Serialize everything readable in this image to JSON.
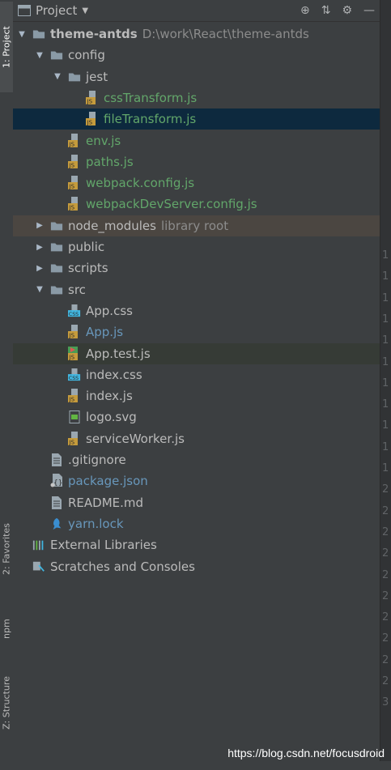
{
  "toolwindow_tabs": {
    "project": "1: Project",
    "favorites": "2: Favorites",
    "npm": "npm",
    "structure": "Z: Structure"
  },
  "header": {
    "title": "Project"
  },
  "tree": [
    {
      "name": "theme-antds",
      "hint": "D:\\work\\React\\theme-antds",
      "icon": "folder-icon",
      "kind": "root"
    },
    {
      "name": "config",
      "icon": "folder-icon",
      "kind": "folder"
    },
    {
      "name": "jest",
      "icon": "folder-icon",
      "kind": "folder"
    },
    {
      "name": "cssTransform.js",
      "icon": "js-file-icon",
      "kind": "green"
    },
    {
      "name": "fileTransform.js",
      "icon": "js-file-icon",
      "kind": "green"
    },
    {
      "name": "env.js",
      "icon": "js-file-icon",
      "kind": "green"
    },
    {
      "name": "paths.js",
      "icon": "js-file-icon",
      "kind": "green"
    },
    {
      "name": "webpack.config.js",
      "icon": "js-file-icon",
      "kind": "green"
    },
    {
      "name": "webpackDevServer.config.js",
      "icon": "js-file-icon",
      "kind": "green"
    },
    {
      "name": "node_modules",
      "hint": "library root",
      "icon": "folder-icon",
      "kind": "folder"
    },
    {
      "name": "public",
      "icon": "folder-icon",
      "kind": "folder"
    },
    {
      "name": "scripts",
      "icon": "folder-icon",
      "kind": "folder"
    },
    {
      "name": "src",
      "icon": "folder-icon",
      "kind": "folder"
    },
    {
      "name": "App.css",
      "icon": "css-file-icon",
      "kind": "white"
    },
    {
      "name": "App.js",
      "icon": "js-file-icon",
      "kind": "blue"
    },
    {
      "name": "App.test.js",
      "icon": "test-file-icon",
      "kind": "white"
    },
    {
      "name": "index.css",
      "icon": "css-file-icon",
      "kind": "white"
    },
    {
      "name": "index.js",
      "icon": "js-file-icon",
      "kind": "white"
    },
    {
      "name": "logo.svg",
      "icon": "svg-file-icon",
      "kind": "white"
    },
    {
      "name": "serviceWorker.js",
      "icon": "js-file-icon",
      "kind": "white"
    },
    {
      "name": ".gitignore",
      "icon": "text-file-icon",
      "kind": "white"
    },
    {
      "name": "package.json",
      "icon": "json-file-icon",
      "kind": "blue"
    },
    {
      "name": "README.md",
      "icon": "text-file-icon",
      "kind": "white"
    },
    {
      "name": "yarn.lock",
      "icon": "yarn-icon",
      "kind": "blue"
    },
    {
      "name": "External Libraries",
      "icon": "libraries-icon",
      "kind": "white"
    },
    {
      "name": "Scratches and Consoles",
      "icon": "scratches-icon",
      "kind": "white"
    }
  ],
  "gutter_numbers": [
    "1",
    "1",
    "1",
    "1",
    "1",
    "1",
    "1",
    "1",
    "1",
    "1",
    "1",
    "2",
    "2",
    "2",
    "2",
    "2",
    "2",
    "2",
    "2",
    "2",
    "2",
    "3"
  ],
  "watermark": "https://blog.csdn.net/focusdroid",
  "colors": {
    "selected_row": "#0d293e",
    "green_file": "#62a66a",
    "blue_file": "#6897bb",
    "folder": "#8a9aa6",
    "js_badge": "#c59b3c"
  }
}
